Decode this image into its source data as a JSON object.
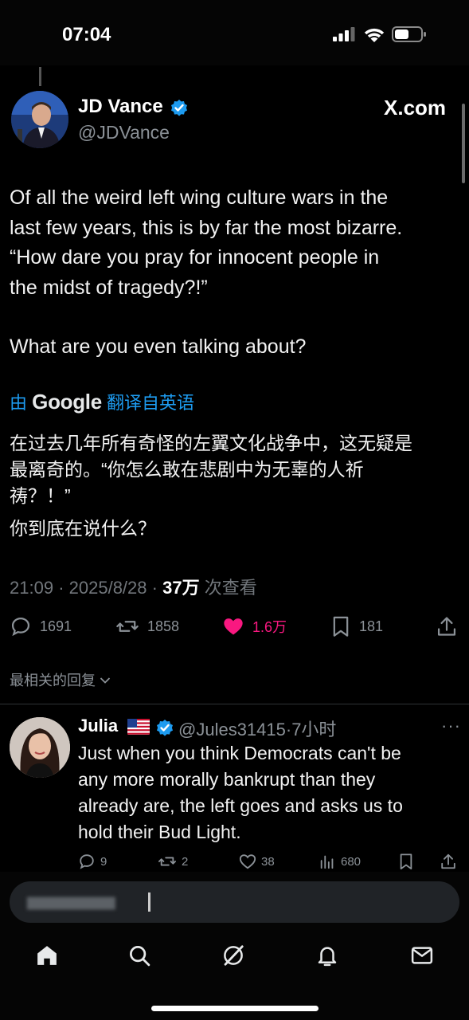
{
  "status_bar": {
    "time": "07:04"
  },
  "tweet": {
    "author_name": "JD Vance",
    "author_handle": "@JDVance",
    "source_label": "X.com",
    "text_lines": [
      "Of all the weird left wing culture wars in the",
      "last few years, this is by far the most bizarre.",
      "“How dare you pray for innocent people in",
      "the midst of tragedy?!”",
      "What are you even talking about?"
    ],
    "translation": {
      "prefix": "由",
      "provider": "Google",
      "suffix": "翻译自英语",
      "lines": [
        "在过去几年所有奇怪的左翼文化战争中，这无疑是",
        "最离奇的。“你怎么敢在悲剧中为无辜的人祈",
        "祷？！”",
        "你到底在说什么？"
      ]
    },
    "meta": {
      "time": "21:09",
      "date": "2025/8/28",
      "separator": "·",
      "views": "37万",
      "views_label": "次查看"
    },
    "stats": {
      "replies": "1691",
      "reposts": "1858",
      "likes": "1.6万",
      "bookmarks": "181"
    },
    "colors": {
      "like_active": "#f91880",
      "link": "#1d9bf0",
      "verified": "#1d9bf0"
    }
  },
  "replies_sort_label": "最相关的回复",
  "reply": {
    "name": "Julia",
    "flag_icon": "us-flag-icon",
    "handle": "@Jules31415",
    "time_ago": "·7小时",
    "more": "···",
    "text_lines": [
      "Just when you think Democrats can't be",
      "any more morally bankrupt than they",
      "already are, the left goes and asks us to",
      "hold their Bud Light."
    ],
    "stats": {
      "replies": "9",
      "reposts": "2",
      "likes": "38",
      "views": "680"
    }
  },
  "nav_icons": [
    "home-icon",
    "search-icon",
    "grok-icon",
    "notifications-icon",
    "messages-icon"
  ]
}
